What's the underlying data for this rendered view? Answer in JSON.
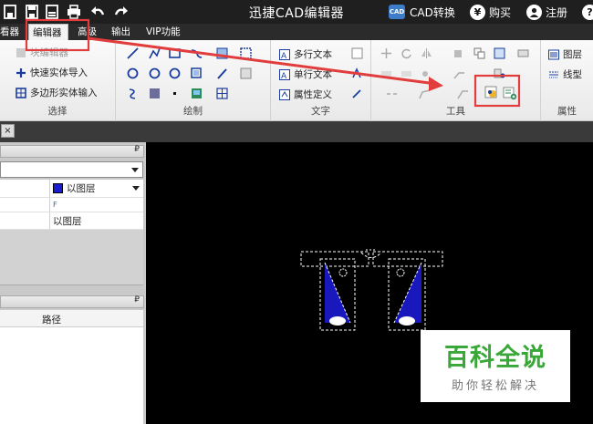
{
  "app": {
    "title": "迅捷CAD编辑器"
  },
  "titlebar": {
    "cad_convert": "CAD转换",
    "cad_icon_text": "CAD",
    "buy": "购买",
    "buy_symbol": "¥",
    "register": "注册",
    "help_symbol": "?"
  },
  "menu": {
    "items": [
      "看器",
      "编辑器",
      "高级",
      "输出",
      "VIP功能"
    ]
  },
  "ribbon": {
    "select_group": {
      "label": "选择",
      "items": [
        "块编辑器",
        "快速实体导入",
        "多边形实体输入"
      ]
    },
    "draw_group": {
      "label": "绘制"
    },
    "text_group": {
      "label": "文字",
      "items": [
        "多行文本",
        "单行文本",
        "属性定义"
      ]
    },
    "tools_group": {
      "label": "工具"
    },
    "props_group": {
      "label": "属性",
      "items": [
        "图层",
        "线型"
      ]
    }
  },
  "props_panel": {
    "pin": "₽",
    "layer_value": "以图层",
    "row2_value": "F",
    "row3_value": "以图层"
  },
  "list_panel": {
    "pin": "₽",
    "col_path": "路径"
  },
  "tab": {
    "close": "×"
  },
  "watermark": {
    "title": "百科全说",
    "subtitle": "助你轻松解决"
  },
  "colors": {
    "accent_red": "#e23d3d",
    "layer_blue": "#1b1bd1",
    "watermark_green": "#3aa839"
  }
}
